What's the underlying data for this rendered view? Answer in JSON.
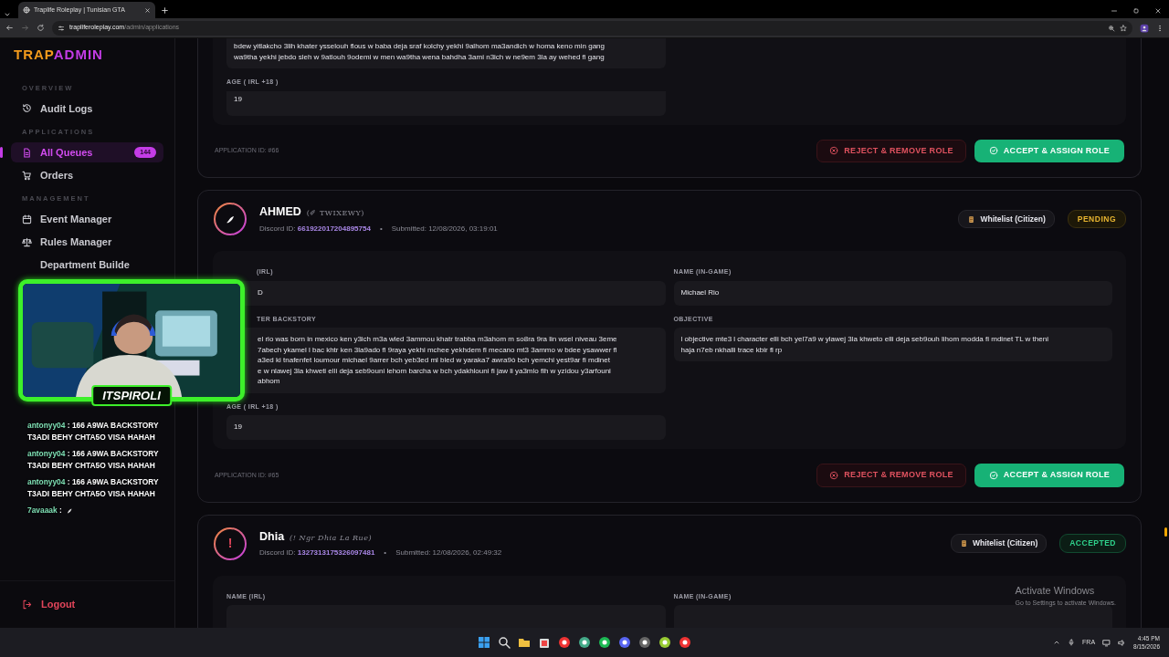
{
  "browser": {
    "tab_title": "Traplife Roleplay | Tunisian GTA",
    "url_domain": "trapliferoleplay.com",
    "url_path": "/admin/applications"
  },
  "sidebar": {
    "logo_first": "TRAP",
    "logo_second": "ADMIN",
    "sections": [
      {
        "title": "OVERVIEW",
        "items": [
          {
            "label": "Audit Logs",
            "selected": false
          }
        ]
      },
      {
        "title": "APPLICATIONS",
        "items": [
          {
            "label": "All Queues",
            "selected": true,
            "count": "144"
          },
          {
            "label": "Orders",
            "selected": false
          }
        ]
      },
      {
        "title": "MANAGEMENT",
        "items": [
          {
            "label": "Event Manager",
            "selected": false
          },
          {
            "label": "Rules Manager",
            "selected": false
          },
          {
            "label": "Department Builde",
            "selected": false
          }
        ]
      }
    ],
    "logout": "Logout"
  },
  "applications": [
    {
      "left_fields": [
        {
          "value_lines": [
            "bdew yitlakcho 3lih khater ysselouh flous w baba deja sraf kolchy yekhi 9alhom ma3andich w homa keno min gang",
            "wa9tha yekhi jebdo sleh w 9atlouh 9odemi w men wa9tha wena bahdha 3ami n3ich w ne9em 3la ay wehed fi gang"
          ]
        },
        {
          "label": "AGE ( IRL +18 )",
          "value_lines": [
            "19"
          ]
        }
      ],
      "app_id": "APPLICATION ID: #66",
      "reject": "REJECT & REMOVE ROLE",
      "accept": "ACCEPT & ASSIGN ROLE"
    },
    {
      "header": {
        "avatar": {
          "kind": "pen"
        },
        "name": "AHMED",
        "nick": "(✐ TWIXEWY)",
        "discord_label": "Discord ID:",
        "discord_id": "661922017204895754",
        "separator": "•",
        "submitted": "Submitted: 12/08/2026, 03:19:01",
        "type": "Whitelist (Citizen)",
        "status": {
          "label": "PENDING",
          "kind": "pending"
        }
      },
      "left_fields": [
        {
          "label": "(IRL)",
          "value_lines": [
            "D"
          ],
          "hidden_start": true
        },
        {
          "label": "TER BACKSTORY",
          "value_lines": [
            "el rio was born in mexico ken y3ich m3a wled 3ammou khatr trabba m3ahom m so8ra 9ra lin wsel niveau 3eme",
            "7abech ykamel l bac khtr ken 3la9ado fl 9raya yekhi mchee yekhdem fl mecano mt3 3ammo w bdee ysawwer fl",
            "a3ed ki tnafenfet loumour michael 9arrer bch yeb3ed ml bled w yaraka7 awra9ò bch yemchi yest9ar fi mdinet",
            "e w nlawej 3la khweti elli deja seb9ouni lehom barcha w bch ydakhlouni fi jaw li ya3mlo fih w yzidou y3arfouni",
            "abhom"
          ],
          "hidden_start": true
        },
        {
          "label": "AGE ( IRL +18 )",
          "value_lines": [
            "19"
          ]
        }
      ],
      "right_fields": [
        {
          "label": "NAME (IN-GAME)",
          "value_lines": [
            "Michael Rio"
          ]
        },
        {
          "label": "OBJECTIVE",
          "value_lines": [
            "l objective mte3 l character elli bch yel7a9 w ylawej 3la khweto elli deja seb9ouh lihom modda fi mdinet TL w theni",
            "haja n7eb nkhalli trace kbir fl rp"
          ]
        }
      ],
      "app_id": "APPLICATION ID: #65",
      "reject": "REJECT & REMOVE ROLE",
      "accept": "ACCEPT & ASSIGN ROLE"
    },
    {
      "header": {
        "avatar": {
          "kind": "text",
          "text": "!"
        },
        "name": "Dhia",
        "nick": "(! Ngr Dhia La Rue)",
        "discord_label": "Discord ID:",
        "discord_id": "1327313175326097481",
        "separator": "•",
        "submitted": "Submitted: 12/08/2026, 02:49:32",
        "type": "Whitelist (Citizen)",
        "status": {
          "label": "ACCEPTED",
          "kind": "accepted"
        }
      },
      "left_fields": [
        {
          "label": "NAME (IRL)"
        }
      ],
      "right_fields": [
        {
          "label": "NAME (IN-GAME)"
        }
      ]
    }
  ],
  "stream_overlay": {
    "streamer": "ITSPIROLI",
    "chat": [
      {
        "user": "antonyy04",
        "text": ": 166 A9WA BACKSTORY T3ADI BEHY CHTA5O VISA HAHAH",
        "emote": false
      },
      {
        "user": "antonyy04",
        "text": ": 166 A9WA BACKSTORY T3ADI BEHY CHTA5O VISA HAHAH",
        "emote": false
      },
      {
        "user": "antonyy04",
        "text": ": 166 A9WA BACKSTORY T3ADI BEHY CHTA5O VISA HAHAH",
        "emote": false
      },
      {
        "user": "7avaaak",
        "text": ":",
        "emote": true
      }
    ]
  },
  "os_notice": {
    "title": "Activate Windows",
    "text": "Go to Settings to activate Windows."
  },
  "taskbar": {
    "language": "FRA",
    "time": "4:45 PM",
    "date": "8/15/2026"
  }
}
